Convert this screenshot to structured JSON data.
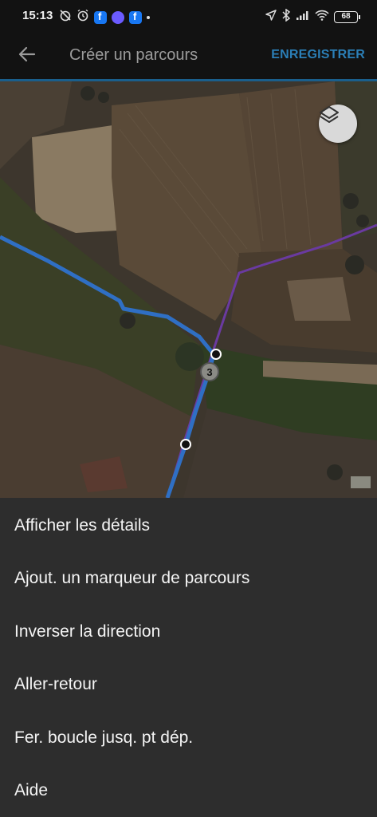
{
  "status_bar": {
    "time": "15:13",
    "battery": "68",
    "left_icons": [
      "alarm-off-icon",
      "alarm-icon",
      "facebook-icon",
      "messenger-icon",
      "facebook-icon",
      "dot-icon"
    ],
    "right_icons": [
      "location-icon",
      "bluetooth-icon",
      "signal-icon",
      "wifi-icon",
      "battery-icon"
    ]
  },
  "app_bar": {
    "back_icon": "arrow-back-icon",
    "title": "Créer un parcours",
    "save_label": "ENREGISTRER"
  },
  "map": {
    "layers_icon": "layers-icon",
    "waypoint_label": "3",
    "route_color": "#2f6fc4",
    "track_color": "#6a3aa0"
  },
  "menu": {
    "items": [
      {
        "label": "Afficher les détails"
      },
      {
        "label": "Ajout. un marqueur de parcours"
      },
      {
        "label": "Inverser la direction"
      },
      {
        "label": "Aller-retour"
      },
      {
        "label": "Fer. boucle jusq. pt dép."
      },
      {
        "label": "Aide"
      }
    ]
  },
  "colors": {
    "accent": "#2b7fb7",
    "background": "#121212",
    "menu_background": "#2d2d2d"
  }
}
